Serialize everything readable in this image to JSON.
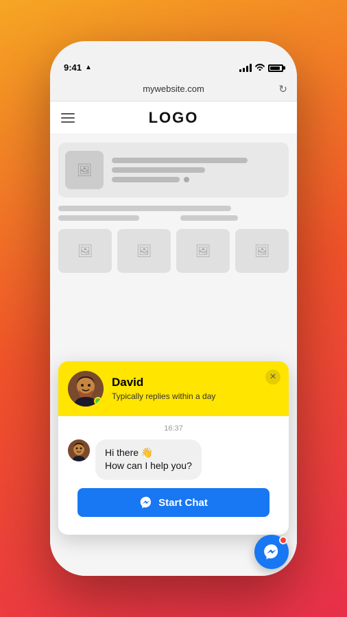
{
  "phone": {
    "status_time": "9:41",
    "browser_url": "mywebsite.com"
  },
  "website": {
    "logo": "LOGO"
  },
  "chat_widget": {
    "close_label": "×",
    "header": {
      "name": "David",
      "status": "Typically replies within a day"
    },
    "timestamp": "16:37",
    "message": {
      "text_line1": "Hi there 👋",
      "text_line2": "How can I help you?"
    },
    "start_chat_label": "Start Chat"
  }
}
